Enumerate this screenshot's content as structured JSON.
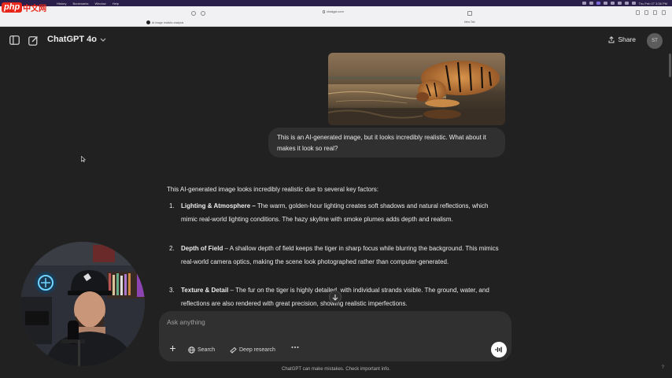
{
  "os_menubar": {
    "menus": [
      "History",
      "Bookmarks",
      "Window",
      "Help"
    ],
    "clock": "Thu Feb 27 3:36 PM"
  },
  "browser": {
    "url": "chatgpt.com",
    "tab_left": "AI image realistic analysis",
    "tab_right": "New Tab"
  },
  "watermark": {
    "brand": "php",
    "suffix": "中文网"
  },
  "header": {
    "model_name": "ChatGPT 4o",
    "share_label": "Share",
    "avatar_initials": "ST"
  },
  "conversation": {
    "user_message": "This is an AI-generated image, but it looks incredibly realistic. What about it makes it look so real?",
    "answer_intro": "This AI-generated image looks incredibly realistic due to several key factors:",
    "points": [
      {
        "num": "1.",
        "title": "Lighting & Atmosphere –",
        "text": " The warm, golden-hour lighting creates soft shadows and natural reflections, which mimic real-world lighting conditions. The hazy skyline with smoke plumes adds depth and realism."
      },
      {
        "num": "2.",
        "title": "Depth of Field",
        "text": " – A shallow depth of field keeps the tiger in sharp focus while blurring the background. This mimics real-world camera optics, making the scene look photographed rather than computer-generated."
      },
      {
        "num": "3.",
        "title": "Texture & Detail",
        "text": " – The fur on the tiger is highly detailed, with individual strands visible. The ground, water, and reflections are also rendered with great precision, showing realistic imperfections."
      }
    ]
  },
  "composer": {
    "placeholder": "Ask anything",
    "search_label": "Search",
    "deep_research_label": "Deep research"
  },
  "footer": {
    "disclaimer": "ChatGPT can make mistakes. Check important info."
  },
  "icons": {
    "sidebar_toggle": "sidebar-icon",
    "new_chat": "new-chat-icon",
    "share": "share-icon",
    "plus": "plus-icon",
    "globe": "globe-icon",
    "telescope": "deep-research-icon",
    "more": "more-icon",
    "voice": "voice-waveform-icon",
    "scroll": "arrow-down-icon"
  },
  "colors": {
    "background": "#212121",
    "bubble": "#303030",
    "text": "#ececec",
    "muted": "#b4b4b4"
  }
}
